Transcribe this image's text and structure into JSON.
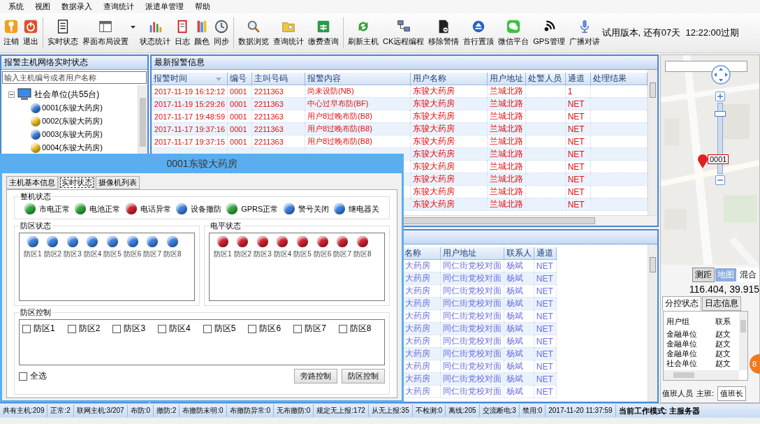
{
  "menu": [
    "系统",
    "视图",
    "数据录入",
    "查询统计",
    "派遣单管理",
    "帮助"
  ],
  "toolbar": {
    "groups": [
      [
        {
          "label": "注销",
          "dropdown": false
        },
        {
          "label": "退出",
          "dropdown": false
        }
      ],
      [
        {
          "label": "实时状态",
          "dropdown": false
        },
        {
          "label": "界面布局设置",
          "dropdown": true
        },
        {
          "label": "状态统计",
          "dropdown": false
        },
        {
          "label": "日志",
          "dropdown": false
        },
        {
          "label": "颜色",
          "dropdown": false
        },
        {
          "label": "同步",
          "dropdown": false
        }
      ],
      [
        {
          "label": "数据浏览",
          "dropdown": false
        },
        {
          "label": "查询统计",
          "dropdown": false
        },
        {
          "label": "缴费查询",
          "dropdown": false
        }
      ],
      [
        {
          "label": "刷新主机",
          "dropdown": false
        },
        {
          "label": "CK远程编程",
          "dropdown": false
        },
        {
          "label": "移除警情",
          "dropdown": false
        },
        {
          "label": "首行置顶",
          "dropdown": false
        },
        {
          "label": "微信平台",
          "dropdown": false
        },
        {
          "label": "GPS管理",
          "dropdown": false
        },
        {
          "label": "广播对讲",
          "dropdown": false
        }
      ]
    ],
    "trial_notice": "试用版本, 还有07天  12:22:00过期"
  },
  "host_panel": {
    "title": "报警主机网络实时状态",
    "search": {
      "placeholder": "输入主机编号或者用户名称"
    },
    "tree": [
      {
        "label": "社会单位(共55台)",
        "expanded": true,
        "children": [
          {
            "label": "0001(东骏大药房)",
            "color": "#3a80e0"
          },
          {
            "label": "0002(东骏大药房)",
            "color": "#f0c020"
          },
          {
            "label": "0003(东骏大药房)",
            "color": "#3a80e0"
          },
          {
            "label": "0004(东骏大药房)",
            "color": "#f0c020"
          }
        ]
      }
    ]
  },
  "alarm_panel": {
    "title": "最新报警信息",
    "columns": [
      "报警时间",
      "编号",
      "主叫号码",
      "报警内容",
      "用户名称",
      "用户地址",
      "处警人员",
      "通道",
      "处理结果"
    ],
    "rows": [
      {
        "time": "2017-11-19 16:12:12",
        "no": "0001",
        "caller": "2211363",
        "content": "尚未设防(NB)",
        "user": "东骏大药房",
        "address": "兰城北路",
        "channel": "1"
      },
      {
        "time": "2017-11-19 15:29:26",
        "no": "0001",
        "caller": "2211363",
        "content": "中心过早布防(BF)",
        "user": "东骏大药房",
        "address": "兰城北路",
        "channel": "NET"
      },
      {
        "time": "2017-11-17 19:48:59",
        "no": "0001",
        "caller": "2211363",
        "content": "用户8过晚布防(B8)",
        "user": "东骏大药房",
        "address": "兰城北路",
        "channel": "NET"
      },
      {
        "time": "2017-11-17 19:37:16",
        "no": "0001",
        "caller": "2211363",
        "content": "用户8过晚布防(B8)",
        "user": "东骏大药房",
        "address": "兰城北路",
        "channel": "NET"
      },
      {
        "time": "2017-11-17 19:37:15",
        "no": "0001",
        "caller": "2211363",
        "content": "用户8过晚布防(B8)",
        "user": "东骏大药房",
        "address": "兰城北路",
        "channel": "NET"
      },
      {
        "user": "东骏大药房",
        "address": "兰城北路",
        "channel": "NET"
      },
      {
        "user": "东骏大药房",
        "address": "兰城北路",
        "channel": "NET"
      },
      {
        "user": "东骏大药房",
        "address": "兰城北路",
        "channel": "NET"
      },
      {
        "user": "东骏大药房",
        "address": "兰城北路",
        "channel": "NET"
      },
      {
        "user": "东骏大药房",
        "address": "兰城北路",
        "channel": "NET"
      }
    ]
  },
  "user_panel": {
    "columns": [
      "名称",
      "用户地址",
      "联系人",
      "通道"
    ],
    "rows": [
      [
        "大药房",
        "同仁街党校对面",
        "杨斌",
        "NET"
      ],
      [
        "大药房",
        "同仁街党校对面",
        "杨斌",
        "NET"
      ],
      [
        "大药房",
        "同仁街党校对面",
        "杨斌",
        "NET"
      ],
      [
        "大药房",
        "同仁街党校对面",
        "杨斌",
        "NET"
      ],
      [
        "大药房",
        "同仁街党校对面",
        "杨斌",
        "NET"
      ],
      [
        "大药房",
        "同仁街党校对面",
        "杨斌",
        "NET"
      ],
      [
        "大药房",
        "同仁街党校对面",
        "杨斌",
        "NET"
      ],
      [
        "大药房",
        "同仁街党校对面",
        "杨斌",
        "NET"
      ],
      [
        "大药房",
        "同仁街党校对面",
        "杨斌",
        "NET"
      ],
      [
        "大药房",
        "同仁街党校对面",
        "杨斌",
        "NET"
      ],
      [
        "大药房",
        "同仁街党校对面",
        "杨斌",
        "NET"
      ]
    ]
  },
  "map": {
    "marker_label": "0001",
    "zoom": {
      "level": 0.85
    },
    "modes": [
      {
        "label": "测距",
        "selected": false
      },
      {
        "label": "地图",
        "selected": true
      },
      {
        "label": "混合",
        "selected": false
      }
    ],
    "coordinates": "116.404, 39.915"
  },
  "side_tabs": [
    {
      "label": "分控状态",
      "selected": true
    },
    {
      "label": "日志信息",
      "selected": false
    }
  ],
  "group_table": {
    "columns": [
      "用户组",
      "联系"
    ],
    "rows": [
      [
        "金融单位",
        "赵文"
      ],
      [
        "金融单位",
        "赵文"
      ],
      [
        "金融单位",
        "赵文"
      ],
      [
        "社会单位",
        "赵文"
      ]
    ]
  },
  "badge": "8",
  "duty": {
    "label": "值班人员",
    "shift_label": "主班:",
    "shift_value": "值班长"
  },
  "status_bar": [
    "共有主机:209",
    "正常:2",
    "联网主机:3/207",
    "布防:0",
    "撤防:2",
    "布撤防未明:0",
    "布撤防异常:0",
    "无布撤防:0",
    "规定无上报:172",
    "从无上报:35",
    "不检测:0",
    "离线:205",
    "交流断电:3",
    "禁用:0",
    "2017-11-20 11:37:59",
    "当前工作模式: 主服务器"
  ],
  "dialog": {
    "title": "0001东骏大药房",
    "tabs": [
      {
        "label": "主机基本信息",
        "selected": false
      },
      {
        "label": "实时状态",
        "selected": true
      },
      {
        "label": "摄像机列表",
        "selected": false
      }
    ],
    "machine_status": {
      "title": "整机状态",
      "items": [
        {
          "label": "市电正常",
          "color": "#2fa83a"
        },
        {
          "label": "电池正常",
          "color": "#2fa83a"
        },
        {
          "label": "电话异常",
          "color": "#d0202e"
        },
        {
          "label": "设备撤防",
          "color": "#3a80e0"
        },
        {
          "label": "GPRS正常",
          "color": "#2fa83a"
        },
        {
          "label": "警号关闭",
          "color": "#3a80e0"
        },
        {
          "label": "继电器关",
          "color": "#3a80e0"
        }
      ]
    },
    "zone_status": {
      "title": "防区状态",
      "zones": [
        {
          "label": "防区1",
          "color": "#3a80e0"
        },
        {
          "label": "防区2",
          "color": "#3a80e0"
        },
        {
          "label": "防区3",
          "color": "#3a80e0"
        },
        {
          "label": "防区4",
          "color": "#3a80e0"
        },
        {
          "label": "防区5",
          "color": "#3a80e0"
        },
        {
          "label": "防区6",
          "color": "#3a80e0"
        },
        {
          "label": "防区7",
          "color": "#3a80e0"
        },
        {
          "label": "防区8",
          "color": "#3a80e0"
        }
      ]
    },
    "level_status": {
      "title": "电平状态",
      "zones": [
        {
          "label": "防区1",
          "color": "#d0202e"
        },
        {
          "label": "防区2",
          "color": "#d0202e"
        },
        {
          "label": "防区3",
          "color": "#d0202e"
        },
        {
          "label": "防区4",
          "color": "#d0202e"
        },
        {
          "label": "防区5",
          "color": "#d0202e"
        },
        {
          "label": "防区6",
          "color": "#d0202e"
        },
        {
          "label": "防区7",
          "color": "#d0202e"
        },
        {
          "label": "防区8",
          "color": "#d0202e"
        }
      ]
    },
    "zone_control": {
      "title": "防区控制",
      "zones": [
        {
          "label": "防区1",
          "checked": false
        },
        {
          "label": "防区2",
          "checked": false
        },
        {
          "label": "防区3",
          "checked": false
        },
        {
          "label": "防区4",
          "checked": false
        },
        {
          "label": "防区5",
          "checked": false
        },
        {
          "label": "防区6",
          "checked": false
        },
        {
          "label": "防区7",
          "checked": false
        },
        {
          "label": "防区8",
          "checked": false
        }
      ],
      "select_all": {
        "label": "全选",
        "checked": false
      },
      "buttons": [
        "旁路控制",
        "防区控制"
      ]
    }
  }
}
